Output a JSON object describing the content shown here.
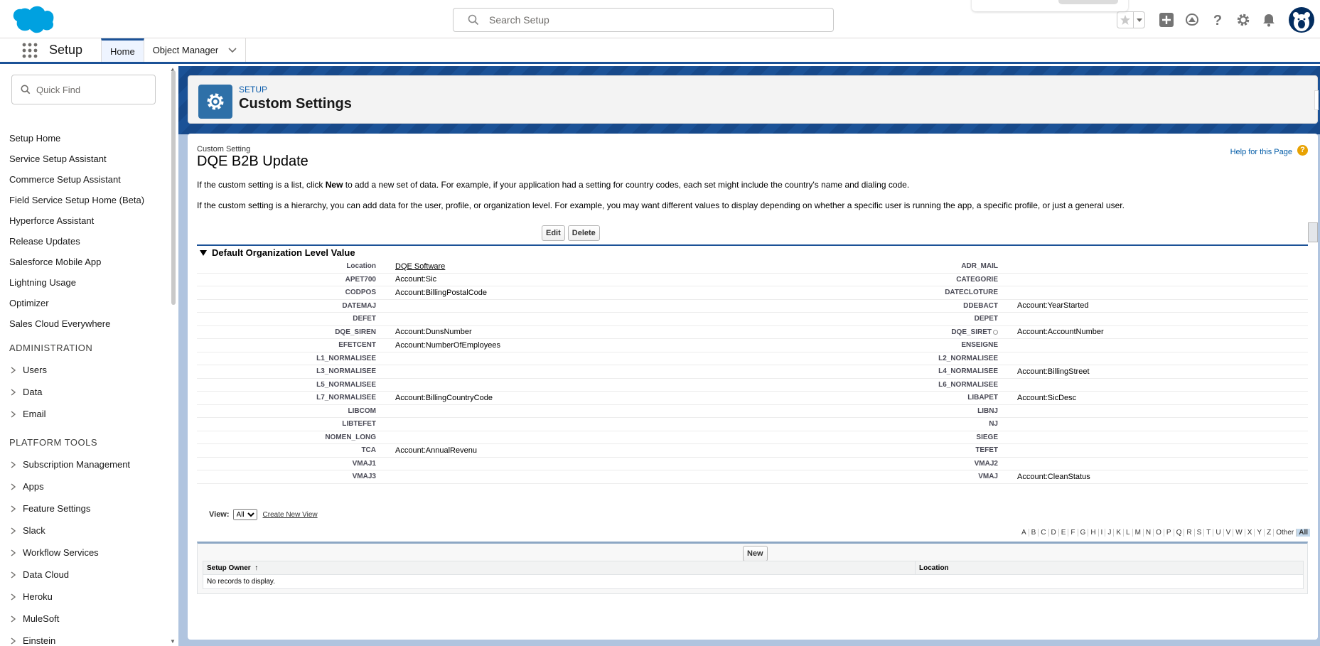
{
  "header": {
    "search_placeholder": "Search Setup",
    "icons": [
      "salesforce-cloud-logo",
      "favorite-star-icon",
      "favorites-dropdown-icon",
      "add-icon",
      "trailhead-icon",
      "help-icon",
      "gear-icon",
      "notification-bell-icon",
      "user-avatar-icon"
    ]
  },
  "context_bar": {
    "app_name": "Setup",
    "tabs": [
      {
        "label": "Home",
        "active": true
      },
      {
        "label": "Object Manager",
        "active": false
      }
    ]
  },
  "sidebar": {
    "quick_find_placeholder": "Quick Find",
    "items": [
      {
        "label": "Setup Home"
      },
      {
        "label": "Service Setup Assistant"
      },
      {
        "label": "Commerce Setup Assistant"
      },
      {
        "label": "Field Service Setup Home (Beta)"
      },
      {
        "label": "Hyperforce Assistant"
      },
      {
        "label": "Release Updates"
      },
      {
        "label": "Salesforce Mobile App"
      },
      {
        "label": "Lightning Usage"
      },
      {
        "label": "Optimizer"
      },
      {
        "label": "Sales Cloud Everywhere"
      }
    ],
    "administration": {
      "title": "ADMINISTRATION",
      "items": [
        {
          "label": "Users"
        },
        {
          "label": "Data"
        },
        {
          "label": "Email"
        }
      ]
    },
    "platform_tools": {
      "title": "PLATFORM TOOLS",
      "items": [
        {
          "label": "Subscription Management"
        },
        {
          "label": "Apps"
        },
        {
          "label": "Feature Settings"
        },
        {
          "label": "Slack"
        },
        {
          "label": "Workflow Services"
        },
        {
          "label": "Data Cloud"
        },
        {
          "label": "Heroku"
        },
        {
          "label": "MuleSoft"
        },
        {
          "label": "Einstein"
        }
      ]
    }
  },
  "page_header": {
    "eyebrow": "SETUP",
    "title": "Custom Settings"
  },
  "detail": {
    "eyebrow": "Custom Setting",
    "title": "DQE B2B Update",
    "help_link": "Help for this Page",
    "desc1_a": "If the custom setting is a list, click ",
    "desc1_b": "New",
    "desc1_c": " to add a new set of data. For example, if your application had a setting for country codes, each set might include the country's name and dialing code.",
    "desc2": "If the custom setting is a hierarchy, you can add data for the user, profile, or organization level. For example, you may want different values to display depending on whether a specific user is running the app, a specific profile, or just a general user.",
    "edit_label": "Edit",
    "delete_label": "Delete",
    "section_title": "Default Organization Level Value",
    "rows": [
      {
        "l1": "Location",
        "v1": "DQE Software",
        "v1_link": true,
        "l2": "ADR_MAIL",
        "v2": ""
      },
      {
        "l1": "APET700",
        "v1": "Account:Sic",
        "l2": "CATEGORIE",
        "v2": ""
      },
      {
        "l1": "CODPOS",
        "v1": "Account:BillingPostalCode",
        "l2": "DATECLOTURE",
        "v2": ""
      },
      {
        "l1": "DATEMAJ",
        "v1": "",
        "l2": "DDEBACT",
        "v2": "Account:YearStarted"
      },
      {
        "l1": "DEFET",
        "v1": "",
        "l2": "DEPET",
        "v2": ""
      },
      {
        "l1": "DQE_SIREN",
        "v1": "Account:DunsNumber",
        "l2": "DQE_SIRET",
        "l2_info": true,
        "v2": "Account:AccountNumber"
      },
      {
        "l1": "EFETCENT",
        "v1": "Account:NumberOfEmployees",
        "l2": "ENSEIGNE",
        "v2": ""
      },
      {
        "l1": "L1_NORMALISEE",
        "v1": "",
        "l2": "L2_NORMALISEE",
        "v2": ""
      },
      {
        "l1": "L3_NORMALISEE",
        "v1": "",
        "l2": "L4_NORMALISEE",
        "v2": "Account:BillingStreet"
      },
      {
        "l1": "L5_NORMALISEE",
        "v1": "",
        "l2": "L6_NORMALISEE",
        "v2": ""
      },
      {
        "l1": "L7_NORMALISEE",
        "v1": "Account:BillingCountryCode",
        "l2": "LIBAPET",
        "v2": "Account:SicDesc"
      },
      {
        "l1": "LIBCOM",
        "v1": "",
        "l2": "LIBNJ",
        "v2": ""
      },
      {
        "l1": "LIBTEFET",
        "v1": "",
        "l2": "NJ",
        "v2": ""
      },
      {
        "l1": "NOMEN_LONG",
        "v1": "",
        "l2": "SIEGE",
        "v2": ""
      },
      {
        "l1": "TCA",
        "v1": "Account:AnnualRevenu",
        "l2": "TEFET",
        "v2": ""
      },
      {
        "l1": "VMAJ1",
        "v1": "",
        "l2": "VMAJ2",
        "v2": ""
      },
      {
        "l1": "VMAJ3",
        "v1": "",
        "l2": "VMAJ",
        "v2": "Account:CleanStatus"
      }
    ]
  },
  "list_view": {
    "view_label": "View:",
    "view_selected": "All",
    "create_new_view": "Create New View",
    "alphabet": [
      "A",
      "B",
      "C",
      "D",
      "E",
      "F",
      "G",
      "H",
      "I",
      "J",
      "K",
      "L",
      "M",
      "N",
      "O",
      "P",
      "Q",
      "R",
      "S",
      "T",
      "U",
      "V",
      "W",
      "X",
      "Y",
      "Z",
      "Other",
      "All"
    ],
    "alphabet_selected": "All",
    "new_label": "New",
    "columns": [
      "Setup Owner",
      "Location"
    ],
    "sort_indicator": "↑",
    "empty_message": "No records to display."
  },
  "colors": {
    "brand_blue": "#1b5297",
    "salesforce_cloud": "#00a1e0",
    "setup_icon_bg": "#2e70a8",
    "help_orange": "#e8a202"
  }
}
